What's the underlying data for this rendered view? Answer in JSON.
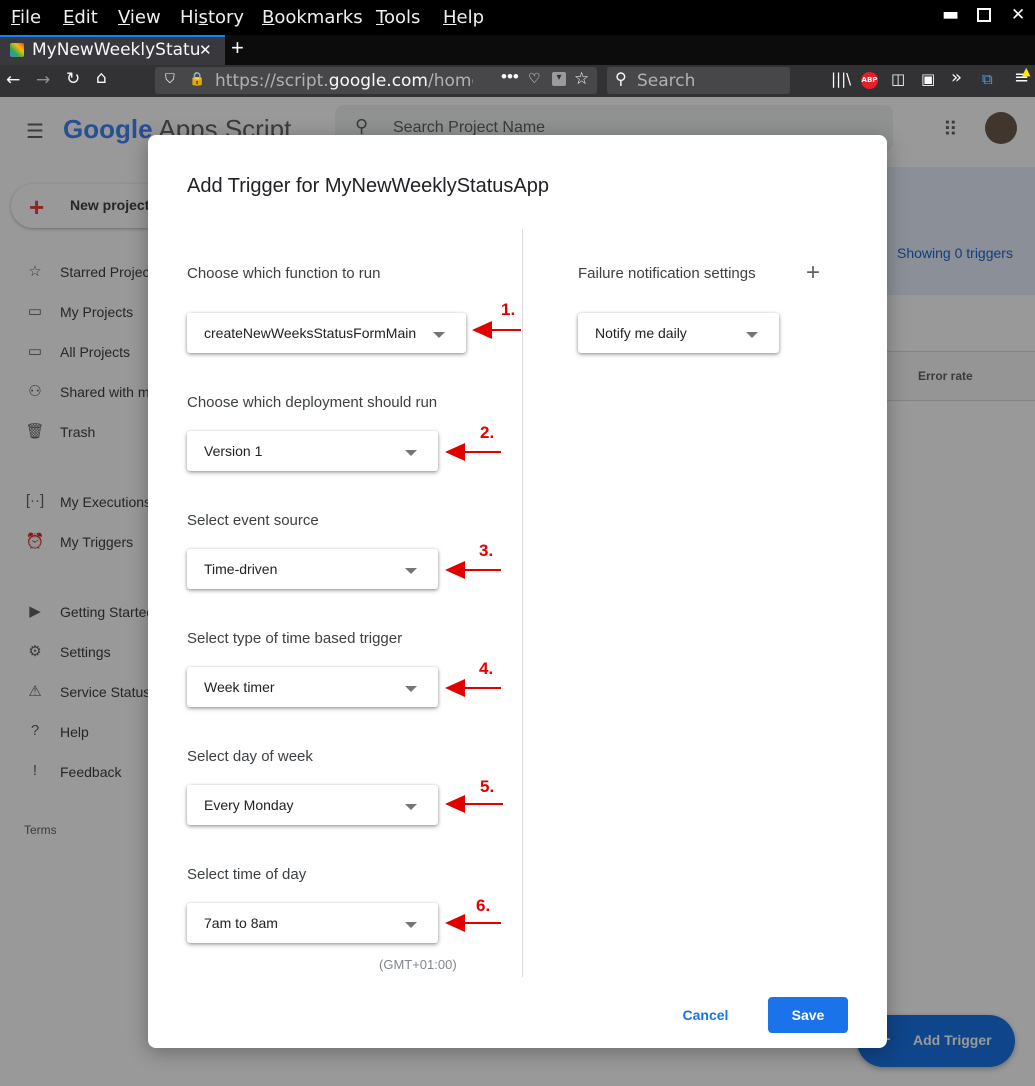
{
  "browser": {
    "menu": [
      "File",
      "Edit",
      "View",
      "History",
      "Bookmarks",
      "Tools",
      "Help"
    ],
    "menu_access_keys": [
      "F",
      "E",
      "V",
      "s",
      "B",
      "T",
      "H"
    ],
    "tab_title": "MyNewWeeklyStatu",
    "url_prefix": "https://script.",
    "url_domain": "google.com",
    "url_suffix": "/home",
    "search_placeholder": "Search"
  },
  "app": {
    "logo_word": "Google",
    "product": "Apps Script",
    "project_search_placeholder": "Search Project Name",
    "new_project_label": "New project",
    "sidebar": [
      {
        "icon": "star-icon",
        "label": "Starred Projects"
      },
      {
        "icon": "folder-icon",
        "label": "My Projects"
      },
      {
        "icon": "folder-icon",
        "label": "All Projects"
      },
      {
        "icon": "shared-icon",
        "label": "Shared with me"
      },
      {
        "icon": "trash-icon",
        "label": "Trash"
      },
      {
        "icon": "executions-icon",
        "label": "My Executions"
      },
      {
        "icon": "alarm-icon",
        "label": "My Triggers"
      },
      {
        "icon": "play-circle-icon",
        "label": "Getting Started"
      },
      {
        "icon": "gear-icon",
        "label": "Settings"
      },
      {
        "icon": "warning-icon",
        "label": "Service Status"
      },
      {
        "icon": "help-icon",
        "label": "Help"
      },
      {
        "icon": "feedback-icon",
        "label": "Feedback"
      }
    ],
    "terms_label": "Terms",
    "showing_triggers": "Showing 0 triggers",
    "error_rate_header": "Error rate",
    "add_trigger_label": "Add Trigger"
  },
  "dialog": {
    "title": "Add Trigger for MyNewWeeklyStatusApp",
    "fields": [
      {
        "label": "Choose which function to run",
        "value": "createNewWeeksStatusFormMain",
        "marker": "1."
      },
      {
        "label": "Choose which deployment should run",
        "value": "Version 1",
        "marker": "2."
      },
      {
        "label": "Select event source",
        "value": "Time-driven",
        "marker": "3."
      },
      {
        "label": "Select type of time based trigger",
        "value": "Week timer",
        "marker": "4."
      },
      {
        "label": "Select day of week",
        "value": "Every Monday",
        "marker": "5."
      },
      {
        "label": "Select time of day",
        "value": "7am to 8am",
        "marker": "6."
      }
    ],
    "timezone": "(GMT+01:00)",
    "failure_label": "Failure notification settings",
    "failure_value": "Notify me daily",
    "cancel_label": "Cancel",
    "save_label": "Save"
  },
  "colors": {
    "accent": "#1a73e8",
    "annotation": "#e00000"
  }
}
